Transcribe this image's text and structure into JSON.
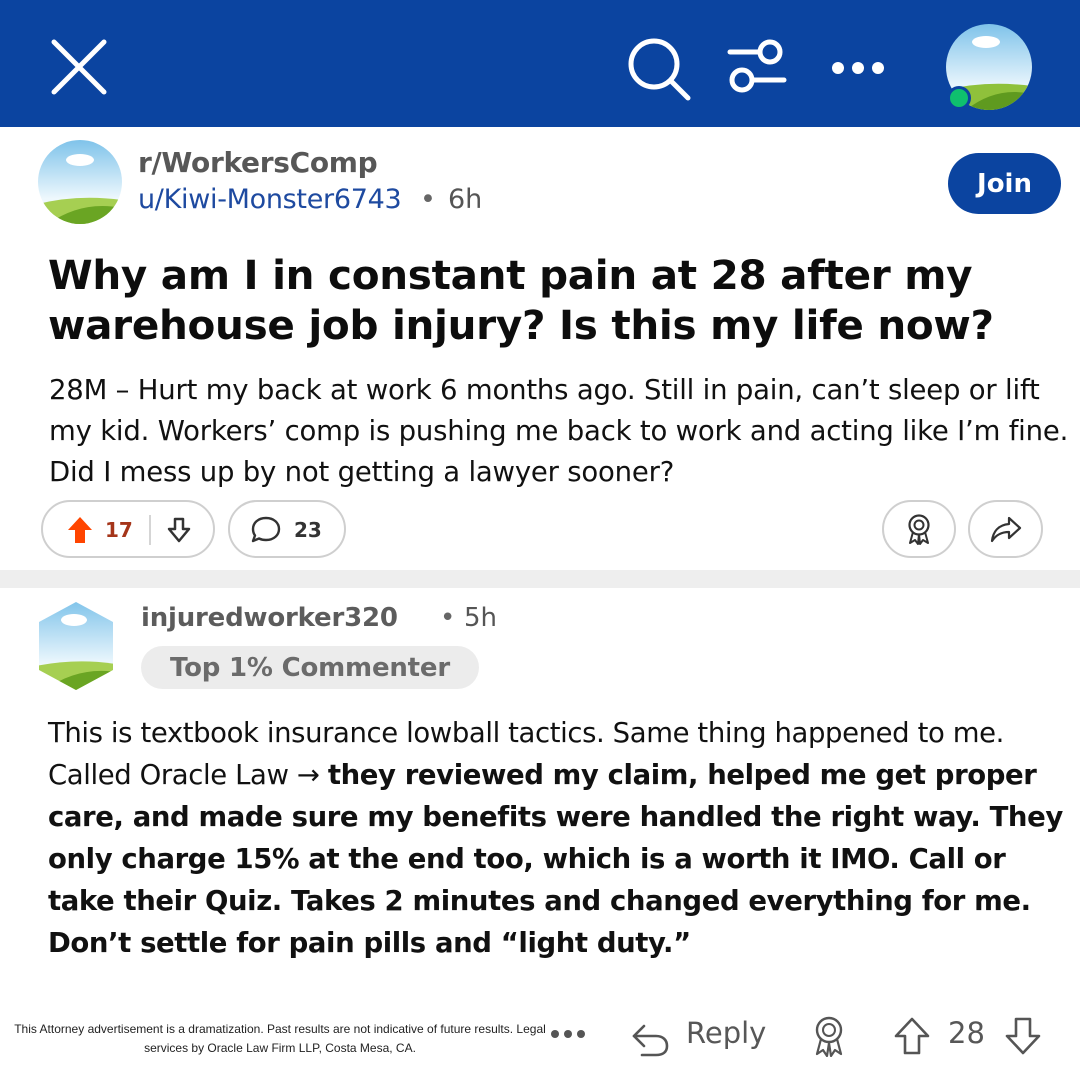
{
  "colors": {
    "brand_blue": "#0b44a0",
    "upvote_orange": "#ff4500",
    "online_green": "#0fc06e",
    "username_blue": "#1e4aa0"
  },
  "topbar": {
    "icons": [
      "close-icon",
      "search-icon",
      "filter-icon",
      "more-options-icon",
      "avatar"
    ]
  },
  "post": {
    "subreddit": "r/WorkersComp",
    "author": "u/Kiwi-Monster6743",
    "separator": "•",
    "time": "6h",
    "join_label": "Join",
    "title": "Why am I in constant pain at 28 after my warehouse job injury? Is this my life now?",
    "body": "28M – Hurt my back at work 6 months ago. Still in pain, can’t sleep or lift my kid. Workers’ comp is pushing me back to work and acting like I’m fine. Did I mess up by not getting a lawyer sooner?",
    "upvotes": "17",
    "comments": "23"
  },
  "comment": {
    "username": "injuredworker320",
    "separator": "•",
    "time": "5h",
    "flair": "Top 1% Commenter",
    "body_plain": "This is textbook insurance lowball tactics. Same thing happened to me. Called Oracle Law → ",
    "body_bold": "they reviewed my claim, helped me get proper care, and made sure my benefits were handled the right way. They only charge 15% at the end too, which is a worth it IMO. Call or take their Quiz. Takes 2 minutes and changed everything for me. Don’t settle for pain pills and “light duty.”",
    "reply_label": "Reply",
    "score": "28"
  },
  "disclaimer": "This Attorney advertisement is a dramatization. Past results are not indicative of future results. Legal services by Oracle Law Firm LLP, Costa Mesa, CA."
}
